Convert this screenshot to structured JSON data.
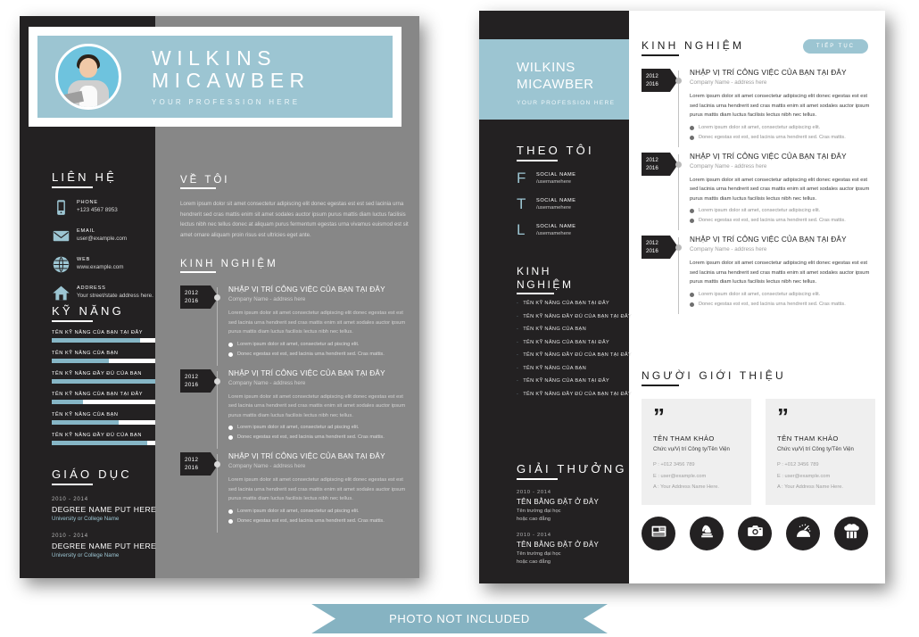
{
  "colors": {
    "accent": "#9cc5d2",
    "dark": "#232122",
    "gray_panel": "#878787",
    "ribbon": "#86b3c2"
  },
  "page1": {
    "header": {
      "name_line1": "WILKINS",
      "name_line2": "MICAWBER",
      "profession": "YOUR PROFESSION HERE"
    },
    "contact": {
      "title": "LIÊN HỆ",
      "items": [
        {
          "icon": "phone-icon",
          "label": "PHONE",
          "value": "+123 4567 8953"
        },
        {
          "icon": "envelope-icon",
          "label": "EMAIL",
          "value": "user@example.com"
        },
        {
          "icon": "globe-icon",
          "label": "WEB",
          "value": "www.example.com"
        },
        {
          "icon": "home-icon",
          "label": "ADDRESS",
          "value": "Your street/state address here."
        }
      ]
    },
    "skills": {
      "title": "KỸ NĂNG",
      "items": [
        {
          "name": "TÊN KỸ NĂNG CỦA BẠN TẠI ĐÂY",
          "percent": 85
        },
        {
          "name": "TÊN KỸ NĂNG CỦA BẠN",
          "percent": 55
        },
        {
          "name": "TÊN KỸ NĂNG ĐẦY ĐỦ CỦA BẠN",
          "percent": 100
        },
        {
          "name": "TÊN KỸ NĂNG CỦA BẠN TẠI ĐÂY",
          "percent": 30
        },
        {
          "name": "TÊN KỸ NĂNG CỦA BẠN",
          "percent": 65
        },
        {
          "name": "TÊN KỸ NĂNG ĐẦY ĐỦ CỦA BẠN",
          "percent": 92
        }
      ]
    },
    "education": {
      "title": "GIÁO DỤC",
      "items": [
        {
          "years": "2010 - 2014",
          "degree": "DEGREE NAME PUT HERE",
          "school": "University or College Name"
        },
        {
          "years": "2010 - 2014",
          "degree": "DEGREE NAME PUT HERE",
          "school": "University or College Name"
        }
      ]
    },
    "about": {
      "title": "VỀ TÔI",
      "body": "Lorem ipsum dolor sit amet consectetur adipiscing elit donec egestas est est sed lacinia urna hendrerit sed cras mattis enim sit amet sodales auctor ipsum purus mattis diam luctus facilisis lectus nibh nec tellus donec at aliquam purus fermentum egestas urna vivamus euismod est sit amet ornare aliquam proin risus est ultricies eget ante."
    },
    "experience": {
      "title": "KINH NGHIỆM",
      "entries": [
        {
          "year_from": "2012",
          "year_to": "2016",
          "role": "NHẬP VỊ TRÍ CÔNG VIỆC CỦA BẠN TẠI ĐÂY",
          "company": "Company Name - address here",
          "desc": "Lorem ipsum dolor sit amet consectetur adipiscing elit donec egestas est est sed lacinia urna hendrerit sed cras mattis enim sit amet sodales auctor ipsum purus mattis diam luctus facilisis lectus nibh nec tellus.",
          "bullets": [
            "Lorem ipsum dolor sit amet, consectetur ad piscing elit.",
            "Donec egestas est est, sed lacinia urna hendrerit sed. Cras mattis."
          ]
        },
        {
          "year_from": "2012",
          "year_to": "2016",
          "role": "NHẬP VỊ TRÍ CÔNG VIỆC CỦA BẠN TẠI ĐÂY",
          "company": "Company Name - address here",
          "desc": "Lorem ipsum dolor sit amet consectetur adipiscing elit donec egestas est est sed lacinia urna hendrerit sed cras mattis enim sit amet sodales auctor ipsum purus mattis diam luctus facilisis lectus nibh nec tellus.",
          "bullets": [
            "Lorem ipsum dolor sit amet, consectetur ad piscing elit.",
            "Donec egestas est est, sed lacinia urna hendrerit sed. Cras mattis."
          ]
        },
        {
          "year_from": "2012",
          "year_to": "2016",
          "role": "NHẬP VỊ TRÍ CÔNG VIỆC CỦA BẠN TẠI ĐÂY",
          "company": "Company Name - address here",
          "desc": "Lorem ipsum dolor sit amet consectetur adipiscing elit donec egestas est est sed lacinia urna hendrerit sed cras mattis enim sit amet sodales auctor ipsum purus mattis diam luctus facilisis lectus nibh nec tellus.",
          "bullets": [
            "Lorem ipsum dolor sit amet, consectetur ad piscing elit.",
            "Donec egestas est est, sed lacinia urna hendrerit sed. Cras mattis."
          ]
        }
      ]
    }
  },
  "page2": {
    "header": {
      "name_line1": "WILKINS",
      "name_line2": "MICAWBER",
      "profession": "YOUR PROFESSION HERE"
    },
    "follow": {
      "title": "THEO TÔI",
      "items": [
        {
          "letter": "F",
          "name": "SOCIAL  NAME",
          "username": "/usernamehere"
        },
        {
          "letter": "T",
          "name": "SOCIAL NAME",
          "username": "/usernamehere"
        },
        {
          "letter": "L",
          "name": "SOCIAL NAME",
          "username": "/usernamehere"
        }
      ]
    },
    "skills": {
      "title_line1": "KINH",
      "title_line2": "NGHIỆM",
      "items": [
        "TÊN KỸ NĂNG CỦA BẠN TẠI ĐÂY",
        "TÊN KỸ NĂNG ĐẦY ĐỦ CỦA BẠN TẠI ĐÂY",
        "TÊN KỸ NĂNG CỦA BẠN",
        "TÊN KỸ NĂNG CỦA BẠN TẠI ĐÂY",
        "TÊN KỸ NĂNG ĐẦY ĐỦ CỦA BẠN TẠI ĐÂY",
        "TÊN KỸ NĂNG CỦA BẠN",
        "TÊN KỸ NĂNG CỦA BẠN TẠI ĐÂY",
        "TÊN KỸ NĂNG ĐẦY ĐỦ CỦA BẠN TẠI ĐÂY"
      ]
    },
    "awards": {
      "title": "GIẢI THƯỞNG",
      "items": [
        {
          "years": "2010 - 2014",
          "title": "TÊN BẰNG ĐẶT Ở ĐÂY",
          "school": "Tên trường đại học\nhoặc cao đẳng"
        },
        {
          "years": "2010 - 2014",
          "title": "TÊN BẰNG ĐẶT Ở ĐÂY",
          "school": "Tên trường đại học\nhoặc cao đẳng"
        }
      ]
    },
    "experience": {
      "title": "KINH NGHIỆM",
      "badge": "TIẾP TỤC",
      "entries": [
        {
          "year_from": "2012",
          "year_to": "2016",
          "role": "NHẬP VỊ TRÍ CÔNG VIỆC CỦA BẠN TẠI ĐÂY",
          "company": "Company Name - address here",
          "desc": "Lorem ipsum dolor sit amet consectetur adipiscing elit donec egestas est est sed lacinia urna hendrerit sed cras mattis enim sit amet sodales auctor ipsum purus mattis diam luctus facilisis lectus nibh nec tellus.",
          "bullets": [
            "Lorem ipsum dolor sit amet, consectetur adipiscing elit.",
            "Donec egestas est est, sed lacinia urna hendrerit sed. Cras mattis."
          ]
        },
        {
          "year_from": "2012",
          "year_to": "2016",
          "role": "NHẬP VỊ TRÍ CÔNG VIỆC CỦA BẠN TẠI ĐÂY",
          "company": "Company Name - address here",
          "desc": "Lorem ipsum dolor sit amet consectetur adipiscing elit donec egestas est est sed lacinia urna hendrerit sed cras mattis enim sit amet sodales auctor ipsum purus mattis diam luctus facilisis lectus nibh nec tellus.",
          "bullets": [
            "Lorem ipsum dolor sit amet, consectetur adipiscing elit.",
            "Donec egestas est est, sed lacinia urna hendrerit sed. Cras mattis."
          ]
        },
        {
          "year_from": "2012",
          "year_to": "2016",
          "role": "NHẬP VỊ TRÍ CÔNG VIỆC CỦA BẠN TẠI ĐÂY",
          "company": "Company Name - address here",
          "desc": "Lorem ipsum dolor sit amet consectetur adipiscing elit donec egestas est est sed lacinia urna hendrerit sed cras mattis enim sit amet sodales auctor ipsum purus mattis diam luctus facilisis lectus nibh nec tellus.",
          "bullets": [
            "Lorem ipsum dolor sit amet, consectetur adipiscing elit.",
            "Donec egestas est est, sed lacinia urna hendrerit sed. Cras mattis."
          ]
        }
      ]
    },
    "references": {
      "title": "NGƯỜI GIỚI THIỆU",
      "cards": [
        {
          "quote": "”",
          "name": "TÊN THAM KHẢO",
          "role": "Chức vụ/Vị trí Công ty/Tên Viện",
          "phone": "P : +012 3456 789",
          "email": "E : user@example.com",
          "address": "A : Your Address Name Here."
        },
        {
          "quote": "”",
          "name": "TÊN THAM KHẢO",
          "role": "Chức vụ/Vị trí Công ty/Tên Viện",
          "phone": "P : +012 3456 789",
          "email": "E : user@example.com",
          "address": "A : Your Address Name Here."
        }
      ]
    },
    "hobbies": [
      {
        "icon": "newspaper-icon"
      },
      {
        "icon": "chess-knight-icon"
      },
      {
        "icon": "camera-icon"
      },
      {
        "icon": "travel-plane-icon"
      },
      {
        "icon": "chef-hat-icon"
      }
    ]
  },
  "ribbon": {
    "label": "PHOTO NOT INCLUDED"
  }
}
